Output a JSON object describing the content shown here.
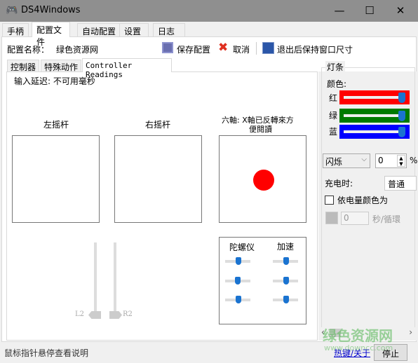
{
  "window": {
    "title": "DS4Windows",
    "minimize": "—",
    "maximize": "☐",
    "close": "✕"
  },
  "tabs": [
    {
      "label": "手柄"
    },
    {
      "label": "配置文件"
    },
    {
      "label": "自动配置"
    },
    {
      "label": "设置"
    },
    {
      "label": "日志"
    }
  ],
  "profile": {
    "name_label": "配置名称：",
    "name_value": "绿色资源网",
    "save": "保存配置",
    "cancel": "取消",
    "keep_size": "退出后保持窗口尺寸"
  },
  "inner_tabs": [
    {
      "label": "控制器"
    },
    {
      "label": "特殊动作"
    },
    {
      "label": "Controller Readings"
    }
  ],
  "readings": {
    "input_delay": "输入延迟: 不可用毫秒",
    "left_stick": "左摇杆",
    "right_stick": "右摇杆",
    "sixaxis": "六軸: X軸已反轉來方",
    "sixaxis2": "便閱讀",
    "gyro": "陀螺仪",
    "accel": "加速",
    "l2": "L2",
    "r2": "R2",
    "dot_color": "#ff0000"
  },
  "lightbar": {
    "title": "灯条",
    "color_label": "颜色:",
    "red": "红",
    "green": "绿",
    "blue": "蓝",
    "red_value": 255,
    "green_value": 255,
    "blue_value": 255,
    "mode": "闪烁",
    "mode_value": "0",
    "percent": "%",
    "charging_label": "充电时:",
    "charging_value": "普通",
    "battery_color": "依电量颜色为",
    "cycle_value": "0",
    "cycle_unit": "秒/循環"
  },
  "status": {
    "hint": "鼠标指针悬停查看说明",
    "hotkeys": "热键/关于",
    "stop": "停止"
  },
  "watermark": {
    "text": "绿色资源网",
    "url": "www.downcc.com"
  }
}
